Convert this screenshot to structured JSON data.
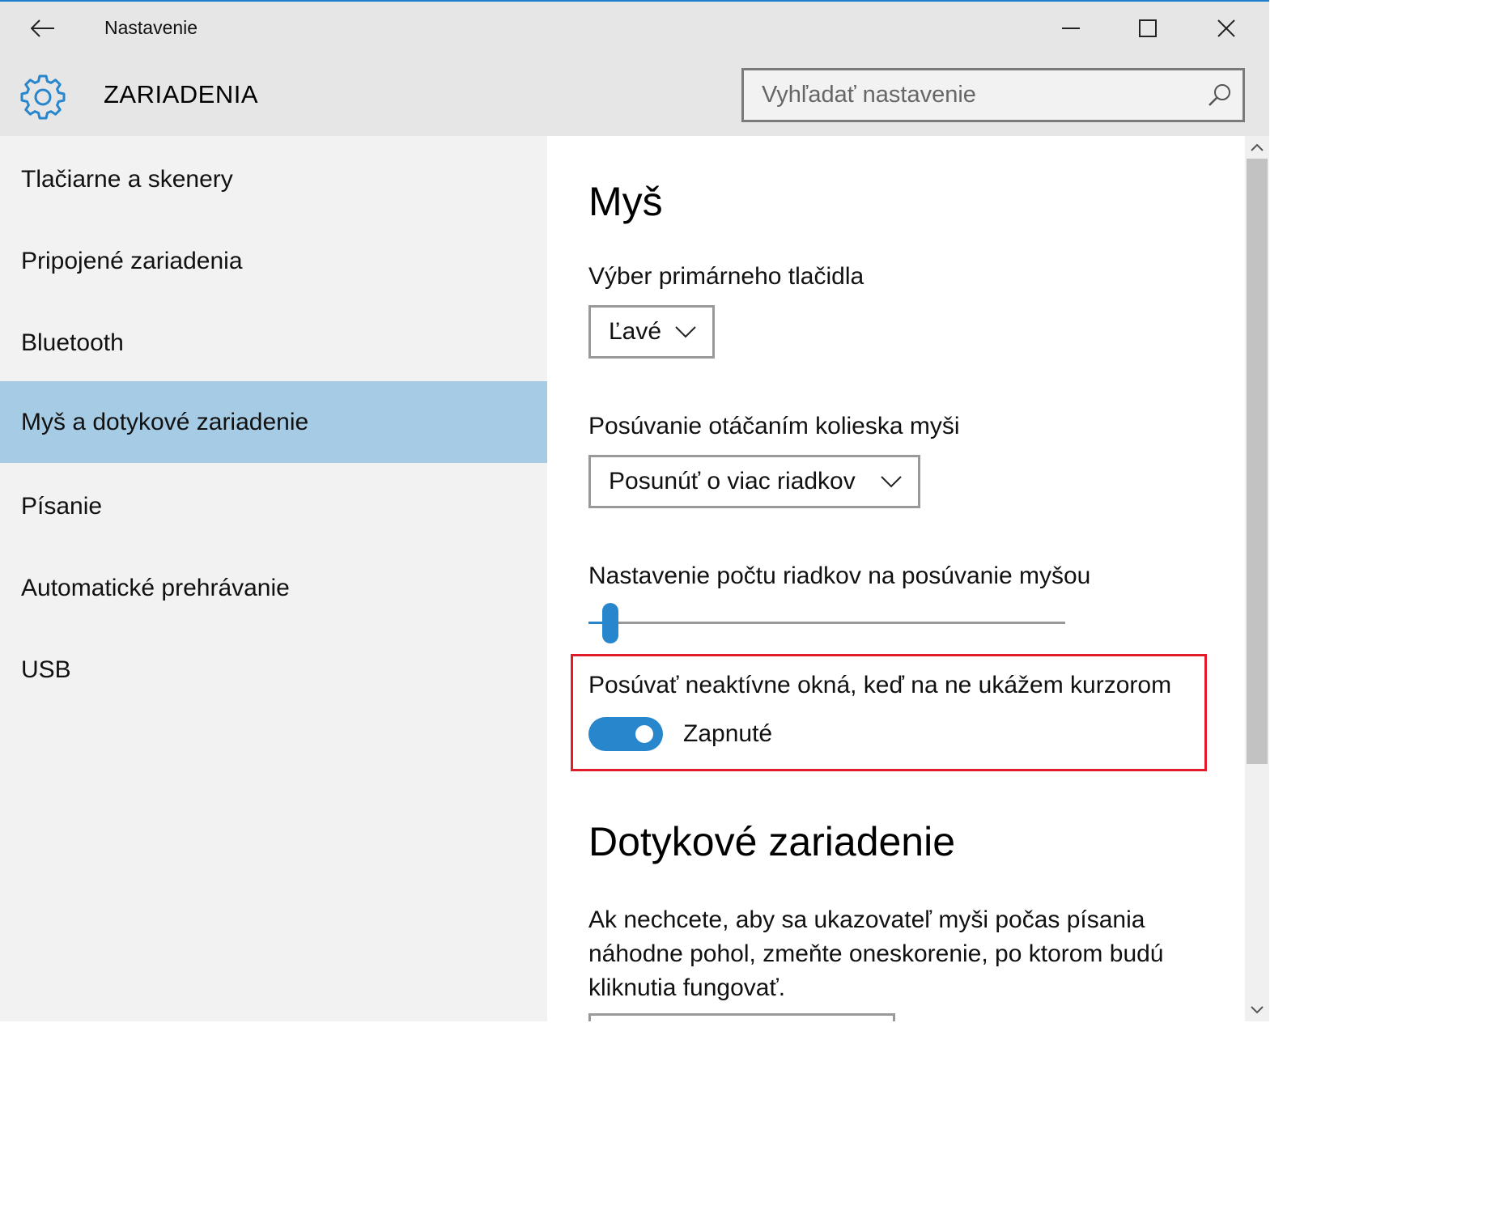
{
  "window": {
    "app_title": "Nastavenie",
    "accent_color": "#2887cc",
    "selected_bg": "#a6cbe4",
    "highlight_color": "#e21b2a"
  },
  "header": {
    "section_title": "ZARIADENIA",
    "search_placeholder": "Vyhľadať nastavenie",
    "icon": "gear-icon"
  },
  "sidebar": {
    "items": [
      {
        "label": "Tlačiarne a skenery",
        "selected": false
      },
      {
        "label": "Pripojené zariadenia",
        "selected": false
      },
      {
        "label": "Bluetooth",
        "selected": false
      },
      {
        "label": "Myš a dotykové zariadenie",
        "selected": true
      },
      {
        "label": "Písanie",
        "selected": false
      },
      {
        "label": "Automatické prehrávanie",
        "selected": false
      },
      {
        "label": "USB",
        "selected": false
      }
    ]
  },
  "main": {
    "mouse_heading": "Myš",
    "primary_button_label": "Výber primárneho tlačidla",
    "primary_button_value": "Ľavé",
    "scroll_mode_label": "Posúvanie otáčaním kolieska myši",
    "scroll_mode_value": "Posunúť o viac riadkov",
    "lines_label": "Nastavenie počtu riadkov na posúvanie myšou",
    "lines_slider_fraction": 0.03,
    "inactive_scroll_label": "Posúvať neaktívne okná, keď na ne ukážem kurzorom",
    "inactive_scroll_state": "Zapnuté",
    "inactive_scroll_on": true,
    "touchpad_heading": "Dotykové zariadenie",
    "touchpad_description": "Ak nechcete, aby sa ukazovateľ myši počas písania náhodne pohol, zmeňte oneskorenie, po ktorom budú kliknutia fungovať."
  }
}
